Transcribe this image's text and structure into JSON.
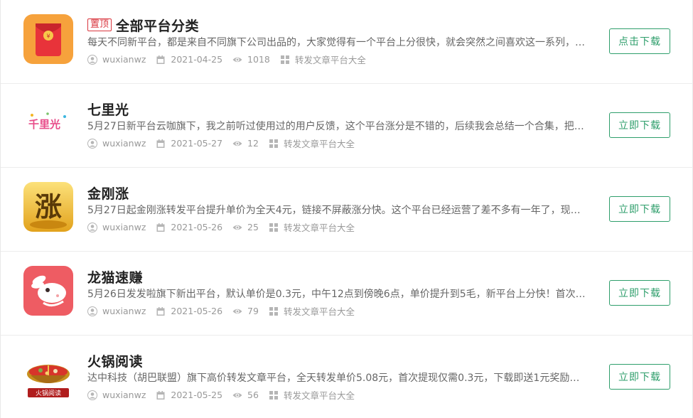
{
  "accent_color": "#2e9e6b",
  "pin_color": "#d9363e",
  "meta_icons": {
    "author": "user-icon",
    "date": "calendar-icon",
    "views": "eye-icon",
    "category": "grid-icon"
  },
  "items": [
    {
      "badge": "置顶",
      "title": "全部平台分类",
      "desc": "每天不同新平台，都是来自不同旗下公司出品的，大家觉得有一个平台上分很快，就会突然之间喜欢这一系列，…",
      "author": "wuxianwz",
      "date": "2021-04-25",
      "views": "1018",
      "category": "转发文章平台大全",
      "button": "点击下载",
      "icon": "red-envelope-icon"
    },
    {
      "title": "七里光",
      "desc": "5月27日新平台云咖旗下，我之前听过使用过的用户反馈，这个平台涨分是不错的，后续我会总结一个合集，把…",
      "author": "wuxianwz",
      "date": "2021-05-27",
      "views": "12",
      "category": "转发文章平台大全",
      "button": "立即下载",
      "icon": "qiliguang-logo-icon",
      "logo_text": "千里光"
    },
    {
      "title": "金刚涨",
      "desc": "5月27日起金刚涨转发平台提升单价为全天4元，链接不屏蔽涨分快。这个平台已经运营了差不多有一年了，现在…",
      "author": "wuxianwz",
      "date": "2021-05-26",
      "views": "25",
      "category": "转发文章平台大全",
      "button": "立即下载",
      "icon": "gold-zhang-icon",
      "logo_text": "涨"
    },
    {
      "title": "龙猫速赚",
      "desc": "5月26日发发啦旗下新出平台，默认单价是0.3元，中午12点到傍晚6点，单价提升到5毛，新平台上分快！首次满…",
      "author": "wuxianwz",
      "date": "2021-05-26",
      "views": "79",
      "category": "转发文章平台大全",
      "button": "立即下载",
      "icon": "rabbit-icon"
    },
    {
      "title": "火锅阅读",
      "desc": "达中科技（胡巴联盟）旗下高价转发文章平台，全天转发单价5.08元，首次提现仅需0.3元，下载即送1元奖励！…",
      "author": "wuxianwz",
      "date": "2021-05-25",
      "views": "56",
      "category": "转发文章平台大全",
      "button": "立即下载",
      "icon": "hotpot-icon",
      "logo_text": "火锅阅读"
    }
  ]
}
